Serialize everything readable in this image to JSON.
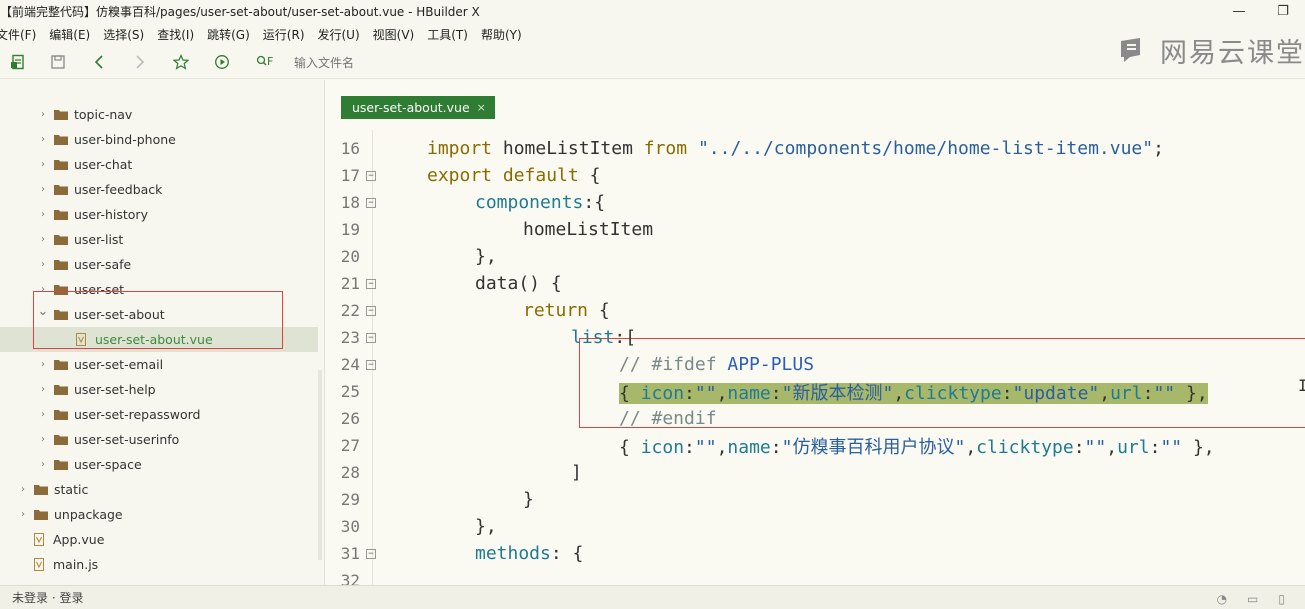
{
  "window": {
    "title": "【前端完整代码】仿糗事百科/pages/user-set-about/user-set-about.vue - HBuilder X",
    "minimize": "—",
    "restore": "❐"
  },
  "menu": [
    "文件(F)",
    "编辑(E)",
    "选择(S)",
    "查找(I)",
    "跳转(G)",
    "运行(R)",
    "发行(U)",
    "视图(V)",
    "工具(T)",
    "帮助(Y)"
  ],
  "toolbar": {
    "search_prefix": "F",
    "search_placeholder": "输入文件名"
  },
  "watermark": "网易云课堂",
  "tree": [
    {
      "label": "topic-nav",
      "type": "folder",
      "level": 2,
      "expanded": false
    },
    {
      "label": "user-bind-phone",
      "type": "folder",
      "level": 2,
      "expanded": false
    },
    {
      "label": "user-chat",
      "type": "folder",
      "level": 2,
      "expanded": false
    },
    {
      "label": "user-feedback",
      "type": "folder",
      "level": 2,
      "expanded": false
    },
    {
      "label": "user-history",
      "type": "folder",
      "level": 2,
      "expanded": false
    },
    {
      "label": "user-list",
      "type": "folder",
      "level": 2,
      "expanded": false
    },
    {
      "label": "user-safe",
      "type": "folder",
      "level": 2,
      "expanded": false
    },
    {
      "label": "user-set",
      "type": "folder",
      "level": 2,
      "expanded": false
    },
    {
      "label": "user-set-about",
      "type": "folder",
      "level": 2,
      "expanded": true
    },
    {
      "label": "user-set-about.vue",
      "type": "file",
      "level": 3,
      "selected": true
    },
    {
      "label": "user-set-email",
      "type": "folder",
      "level": 2,
      "expanded": false
    },
    {
      "label": "user-set-help",
      "type": "folder",
      "level": 2,
      "expanded": false
    },
    {
      "label": "user-set-repassword",
      "type": "folder",
      "level": 2,
      "expanded": false
    },
    {
      "label": "user-set-userinfo",
      "type": "folder",
      "level": 2,
      "expanded": false
    },
    {
      "label": "user-space",
      "type": "folder",
      "level": 2,
      "expanded": false
    },
    {
      "label": "static",
      "type": "folder",
      "level": 1,
      "expanded": false
    },
    {
      "label": "unpackage",
      "type": "folder",
      "level": 1,
      "expanded": false
    },
    {
      "label": "App.vue",
      "type": "file",
      "level": 1
    },
    {
      "label": "main.js",
      "type": "file",
      "level": 1
    }
  ],
  "editor": {
    "tab_label": "user-set-about.vue",
    "tab_close": "×",
    "lines": [
      {
        "n": "16",
        "fold": false,
        "html": "<span class=\"kw\">import</span> homeListItem <span class=\"kw\">from</span> <span class=\"str\">\"../../components/home/home-list-item.vue\"</span>;",
        "indent": 0
      },
      {
        "n": "17",
        "fold": true,
        "html": "<span class=\"kw\">export</span> <span class=\"kw\">default</span> {",
        "indent": 0
      },
      {
        "n": "18",
        "fold": true,
        "html": "<span class=\"kw2\">components</span>:{",
        "indent": 1
      },
      {
        "n": "19",
        "fold": false,
        "html": "homeListItem",
        "indent": 2
      },
      {
        "n": "20",
        "fold": false,
        "html": "},",
        "indent": 1
      },
      {
        "n": "21",
        "fold": true,
        "html": "data() {",
        "indent": 1
      },
      {
        "n": "22",
        "fold": true,
        "html": "<span class=\"kw\">return</span> {",
        "indent": 2
      },
      {
        "n": "23",
        "fold": true,
        "html": "<span class=\"kw2\">list</span>:[",
        "indent": 3
      },
      {
        "n": "24",
        "fold": true,
        "html": "<span class=\"cmt\">// #ifdef </span><span class=\"dir\">APP-PLUS</span>",
        "indent": 4
      },
      {
        "n": "25",
        "fold": false,
        "html": "<span class=\"hl\">{ <span class=\"kw2\">icon</span>:<span class=\"str\">\"\"</span>,<span class=\"kw2\">name</span>:<span class=\"str\">\"新版本检测\"</span>,<span class=\"kw2\">clicktype</span>:<span class=\"str\">\"update\"</span>,<span class=\"kw2\">url</span>:<span class=\"str\">\"\"</span> },</span>",
        "indent": 4
      },
      {
        "n": "26",
        "fold": false,
        "html": "<span class=\"cmt\">// #endif</span>",
        "indent": 4
      },
      {
        "n": "27",
        "fold": false,
        "html": "{ <span class=\"kw2\">icon</span>:<span class=\"str\">\"\"</span>,<span class=\"kw2\">name</span>:<span class=\"str\">\"仿糗事百科用户协议\"</span>,<span class=\"kw2\">clicktype</span>:<span class=\"str\">\"\"</span>,<span class=\"kw2\">url</span>:<span class=\"str\">\"\"</span> },",
        "indent": 4
      },
      {
        "n": "28",
        "fold": false,
        "html": "]",
        "indent": 3
      },
      {
        "n": "29",
        "fold": false,
        "html": "}",
        "indent": 2
      },
      {
        "n": "30",
        "fold": false,
        "html": "},",
        "indent": 1
      },
      {
        "n": "31",
        "fold": true,
        "html": "<span class=\"kw2\">methods</span>: {",
        "indent": 1
      },
      {
        "n": "32",
        "fold": false,
        "html": "",
        "indent": 0
      }
    ]
  },
  "status": {
    "left": "未登录 · 登录",
    "right_icons": [
      "chat-icon",
      "minimize-panel-icon",
      "close-panel-icon"
    ]
  }
}
